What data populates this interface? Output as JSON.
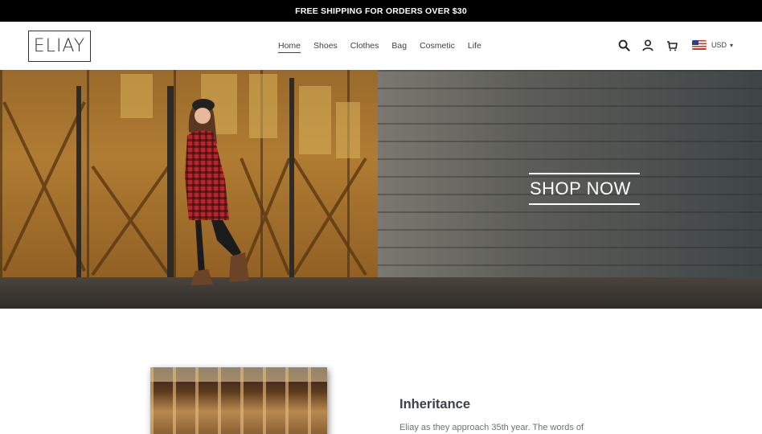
{
  "announcement": {
    "text": "FREE SHIPPING FOR ORDERS OVER $30"
  },
  "header": {
    "logo_text": "ELIAY",
    "nav": [
      {
        "label": "Home",
        "active": true
      },
      {
        "label": "Shoes",
        "active": false
      },
      {
        "label": "Clothes",
        "active": false
      },
      {
        "label": "Bag",
        "active": false
      },
      {
        "label": "Cosmetic",
        "active": false
      },
      {
        "label": "Life",
        "active": false
      }
    ],
    "icons": [
      "search-icon",
      "account-icon",
      "cart-icon"
    ],
    "currency": {
      "code": "USD",
      "flag": "us-flag-icon"
    }
  },
  "hero": {
    "cta_label": "SHOP NOW"
  },
  "feature": {
    "title": "Inheritance",
    "text": "Eliay as they approach 35th year. The words of"
  },
  "colors": {
    "accent": "#000000",
    "text": "#3d4246",
    "muted": "#69727b"
  }
}
